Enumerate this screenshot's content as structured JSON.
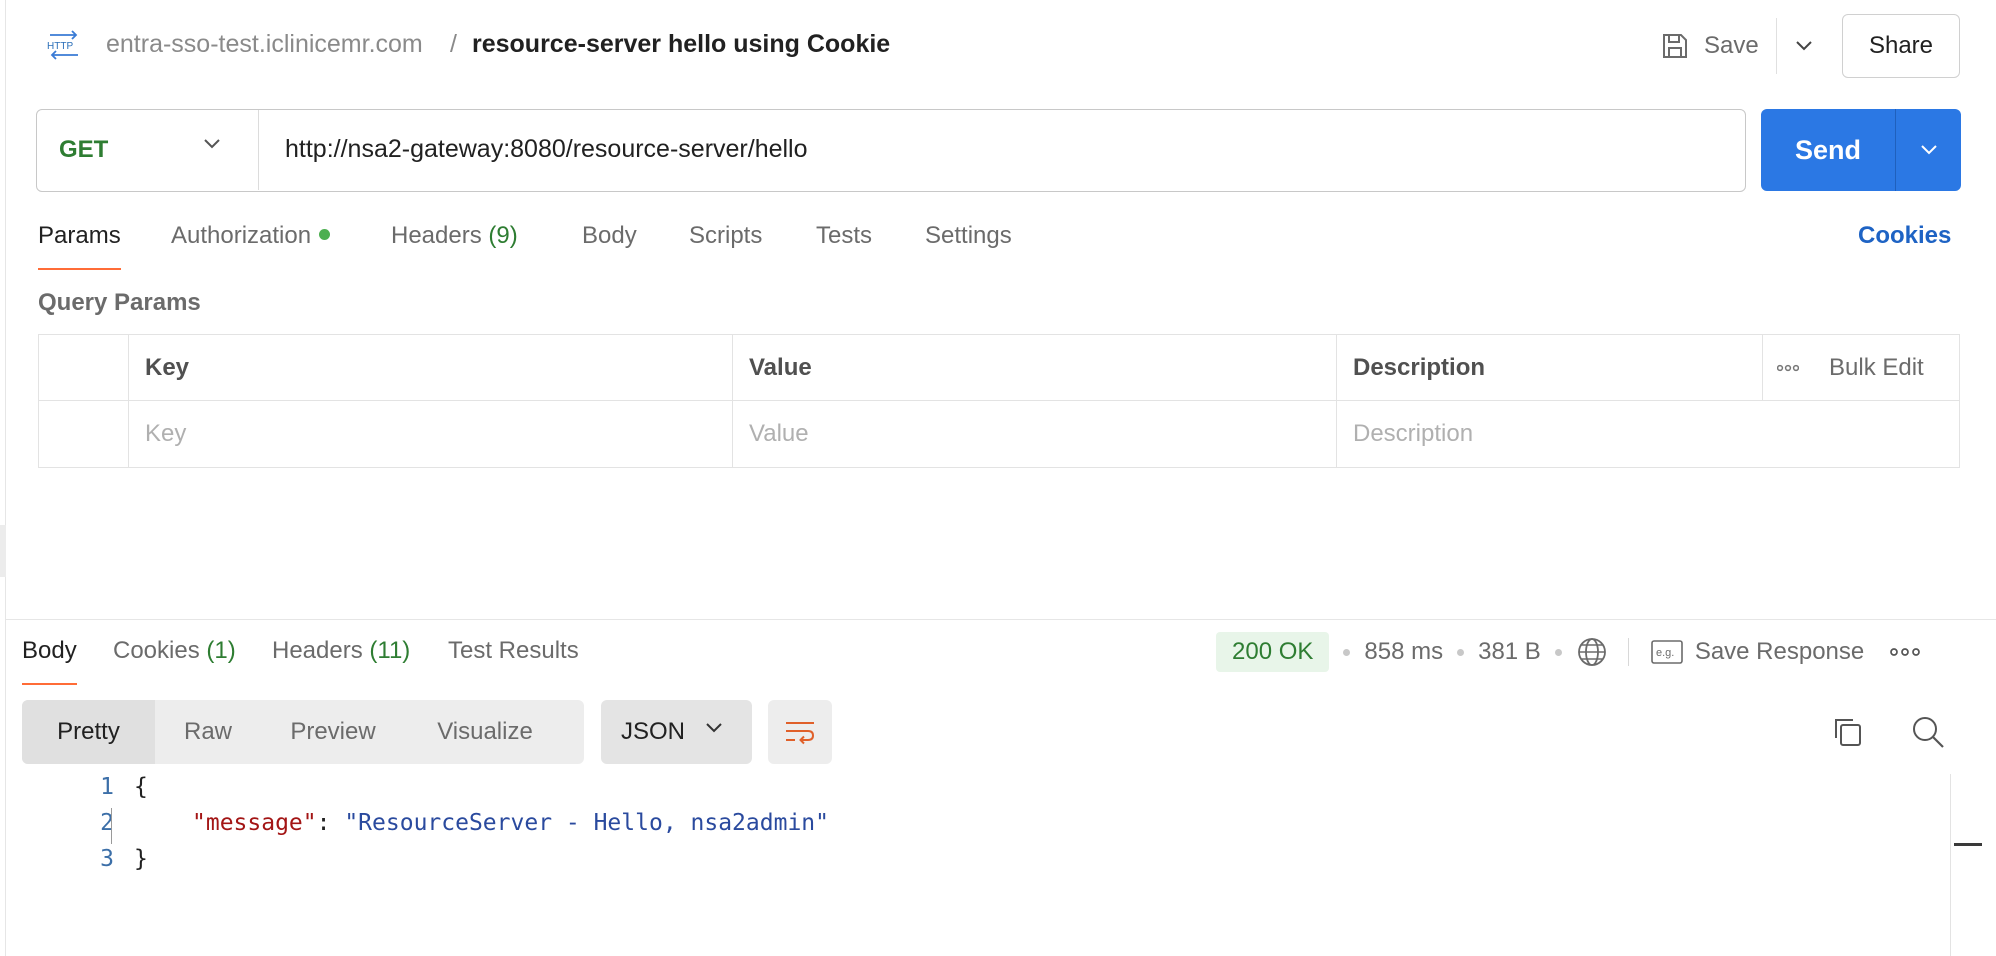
{
  "header": {
    "host": "entra-sso-test.iclinicemr.com",
    "separator": "/",
    "title": "resource-server hello using Cookie",
    "save_label": "Save",
    "share_label": "Share",
    "http_icon": "http-icon"
  },
  "request": {
    "method": "GET",
    "url": "http://nsa2-gateway:8080/resource-server/hello",
    "send_label": "Send"
  },
  "request_tabs": {
    "params": "Params",
    "authorization": "Authorization",
    "headers": "Headers",
    "headers_count": "(9)",
    "body": "Body",
    "scripts": "Scripts",
    "tests": "Tests",
    "settings": "Settings",
    "cookies": "Cookies",
    "active": "Params"
  },
  "query_params": {
    "title": "Query Params",
    "columns": {
      "key": "Key",
      "value": "Value",
      "description": "Description"
    },
    "bulk_edit": "Bulk Edit",
    "placeholders": {
      "key": "Key",
      "value": "Value",
      "description": "Description"
    }
  },
  "response_tabs": {
    "body": "Body",
    "cookies": "Cookies",
    "cookies_count": "(1)",
    "headers": "Headers",
    "headers_count": "(11)",
    "test_results": "Test Results",
    "active": "Body"
  },
  "response_stats": {
    "status": "200 OK",
    "time": "858 ms",
    "size": "381 B",
    "save_response": "Save Response",
    "eg_icon_text": "e.g."
  },
  "view": {
    "modes": [
      "Pretty",
      "Raw",
      "Preview",
      "Visualize"
    ],
    "active": "Pretty",
    "format": "JSON"
  },
  "code": {
    "line_numbers": [
      "1",
      "2",
      "3"
    ],
    "open": "{",
    "key": "\"message\"",
    "colon": ": ",
    "value": "\"ResourceServer - Hello, nsa2admin\"",
    "close": "}"
  },
  "colors": {
    "accent": "#ff6c37",
    "send": "#2b78e4",
    "method": "#2e7d32",
    "link": "#1e63c4"
  }
}
